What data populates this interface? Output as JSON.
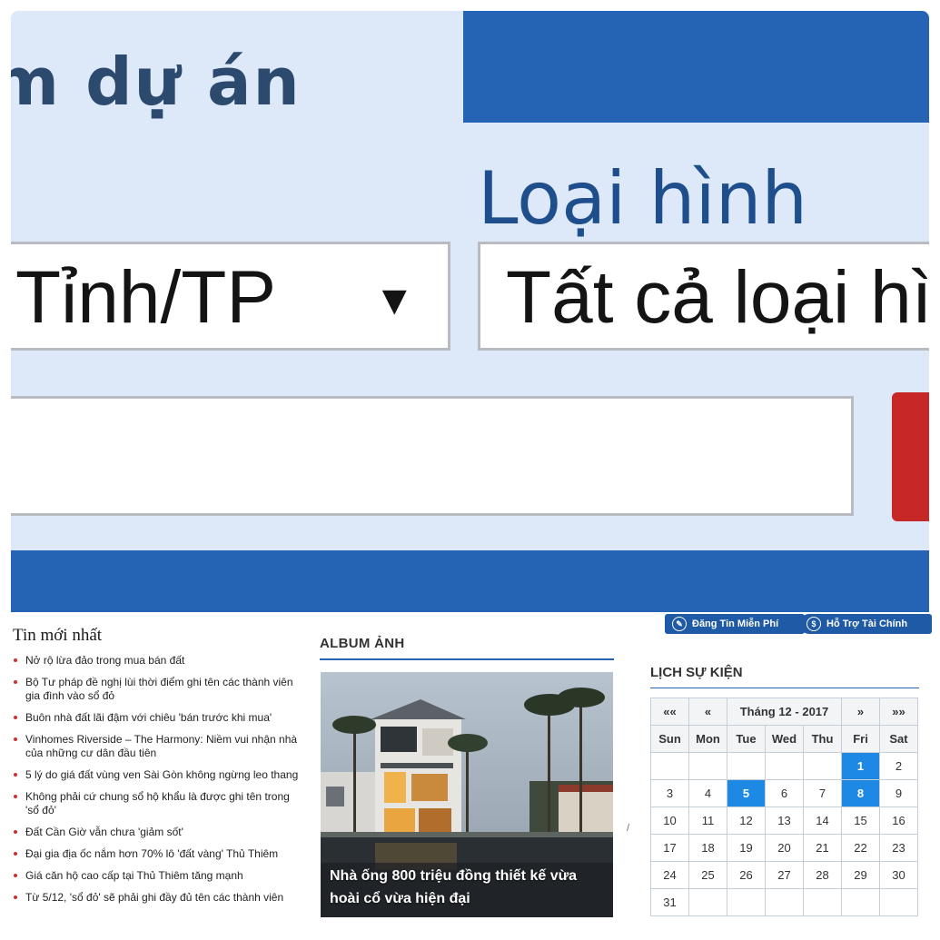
{
  "search_panel": {
    "project_heading": "m dự án",
    "type_label": "Loại hình",
    "province_select": "Tỉnh/TP",
    "province_arrow": "▼",
    "type_select": "Tất cả loại hì"
  },
  "news": {
    "title": "Tin mới nhất",
    "items": [
      "Nở rộ lừa đảo trong mua bán đất",
      "Bộ Tư pháp đề nghị lùi thời điểm ghi tên các thành viên gia đình vào sổ đỏ",
      "Buôn nhà đất lãi đậm với chiêu 'bán trước khi mua'",
      "Vinhomes Riverside – The Harmony: Niềm vui nhận nhà của những cư dân đầu tiên",
      "5 lý do giá đất vùng ven Sài Gòn không ngừng leo thang",
      "Không phải cứ chung sổ hộ khẩu là được ghi tên trong 'sổ đỏ'",
      "Đất Cần Giờ vẫn chưa 'giảm sốt'",
      "Đại gia địa ốc nắm hơn 70% lô 'đất vàng' Thủ Thiêm",
      "Giá căn hộ cao cấp tại Thủ Thiêm tăng mạnh",
      "Từ 5/12, 'sổ đỏ' sẽ phải ghi đầy đủ tên các thành viên"
    ]
  },
  "album": {
    "heading": "ALBUM ẢNH",
    "caption": "Nhà ống 800 triệu đồng thiết kế vừa hoài cổ vừa hiện đại"
  },
  "buttons": {
    "post_free": "Đăng Tin Miễn Phí",
    "finance": "Hỗ Trợ Tài Chính"
  },
  "calendar": {
    "heading": "LỊCH SỰ KIỆN",
    "nav": {
      "prev_year": "««",
      "prev_month": "«",
      "next_month": "»",
      "next_year": "»»"
    },
    "month_label": "Tháng 12 - 2017",
    "weekdays": [
      "Sun",
      "Mon",
      "Tue",
      "Wed",
      "Thu",
      "Fri",
      "Sat"
    ],
    "weeks": [
      [
        "",
        "",
        "",
        "",
        "",
        "1",
        "2"
      ],
      [
        "3",
        "4",
        "5",
        "6",
        "7",
        "8",
        "9"
      ],
      [
        "10",
        "11",
        "12",
        "13",
        "14",
        "15",
        "16"
      ],
      [
        "17",
        "18",
        "19",
        "20",
        "21",
        "22",
        "23"
      ],
      [
        "24",
        "25",
        "26",
        "27",
        "28",
        "29",
        "30"
      ],
      [
        "31",
        "",
        "",
        "",
        "",
        "",
        ""
      ]
    ],
    "highlighted_days": [
      "1",
      "5",
      "8"
    ]
  },
  "colors": {
    "brand_blue": "#2563b5",
    "highlight_blue": "#1e88e5",
    "search_red": "#c62828",
    "panel_bg": "#dde9f8"
  }
}
